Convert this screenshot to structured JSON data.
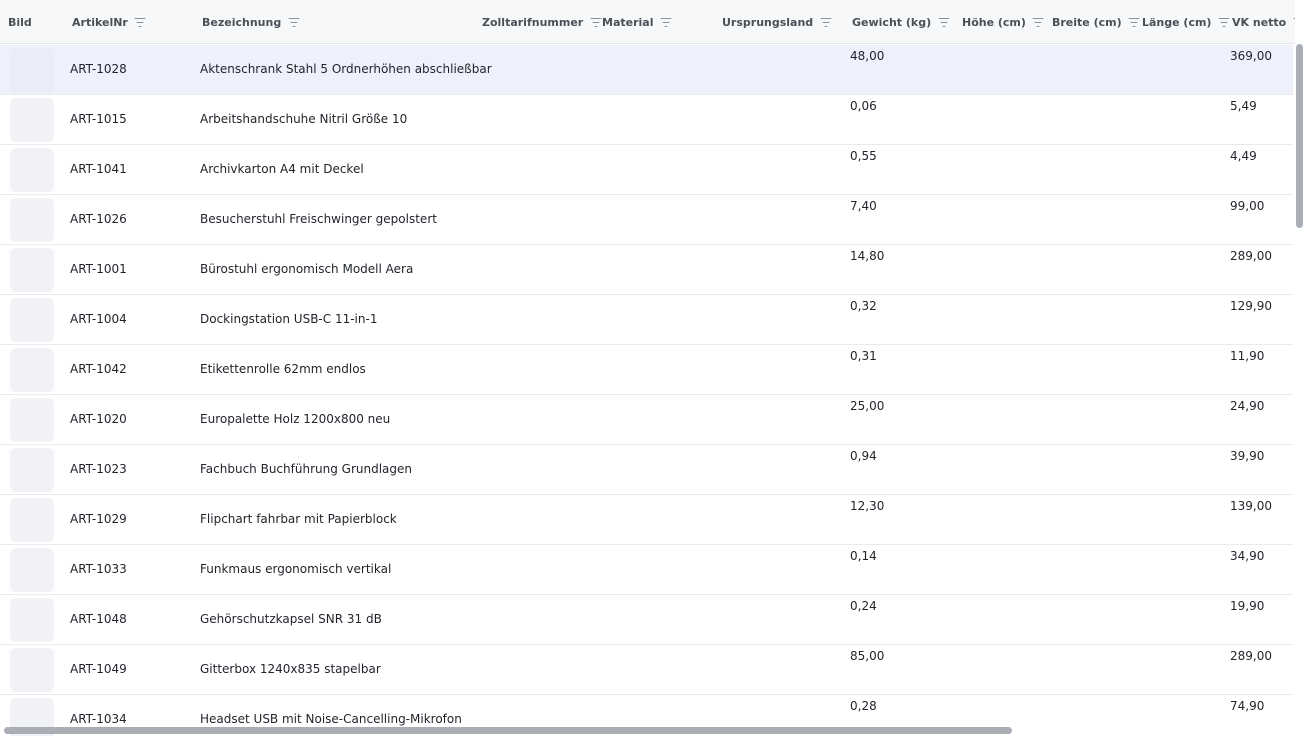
{
  "columns": {
    "bild": "Bild",
    "artikelnr": "ArtikelNr",
    "bezeichnung": "Bezeichnung",
    "zolltarifnummer": "Zolltarifnummer",
    "material": "Material",
    "ursprungsland": "Ursprungsland",
    "gewicht": "Gewicht (kg)",
    "hoehe": "Höhe (cm)",
    "breite": "Breite (cm)",
    "laenge": "Länge (cm)",
    "vknetto": "VK netto"
  },
  "rows": [
    {
      "nr": "ART-1028",
      "name": "Aktenschrank Stahl 5 Ordnerhöhen abschließbar",
      "gewicht": "48,00",
      "vk": "369,00",
      "selected": true
    },
    {
      "nr": "ART-1015",
      "name": "Arbeitshandschuhe Nitril Größe 10",
      "gewicht": "0,06",
      "vk": "5,49"
    },
    {
      "nr": "ART-1041",
      "name": "Archivkarton A4 mit Deckel",
      "gewicht": "0,55",
      "vk": "4,49"
    },
    {
      "nr": "ART-1026",
      "name": "Besucherstuhl Freischwinger gepolstert",
      "gewicht": "7,40",
      "vk": "99,00"
    },
    {
      "nr": "ART-1001",
      "name": "Bürostuhl ergonomisch Modell Aera",
      "gewicht": "14,80",
      "vk": "289,00"
    },
    {
      "nr": "ART-1004",
      "name": "Dockingstation USB-C 11-in-1",
      "gewicht": "0,32",
      "vk": "129,90"
    },
    {
      "nr": "ART-1042",
      "name": "Etikettenrolle 62mm endlos",
      "gewicht": "0,31",
      "vk": "11,90"
    },
    {
      "nr": "ART-1020",
      "name": "Europalette Holz 1200x800 neu",
      "gewicht": "25,00",
      "vk": "24,90"
    },
    {
      "nr": "ART-1023",
      "name": "Fachbuch Buchführung Grundlagen",
      "gewicht": "0,94",
      "vk": "39,90"
    },
    {
      "nr": "ART-1029",
      "name": "Flipchart fahrbar mit Papierblock",
      "gewicht": "12,30",
      "vk": "139,00"
    },
    {
      "nr": "ART-1033",
      "name": "Funkmaus ergonomisch vertikal",
      "gewicht": "0,14",
      "vk": "34,90"
    },
    {
      "nr": "ART-1048",
      "name": "Gehörschutzkapsel SNR 31 dB",
      "gewicht": "0,24",
      "vk": "19,90"
    },
    {
      "nr": "ART-1049",
      "name": "Gitterbox 1240x835 stapelbar",
      "gewicht": "85,00",
      "vk": "289,00"
    },
    {
      "nr": "ART-1034",
      "name": "Headset USB mit Noise-Cancelling-Mikrofon",
      "gewicht": "0,28",
      "vk": "74,90"
    }
  ],
  "icons": {
    "filter": "filter-icon",
    "thumbnail": "image-placeholder"
  },
  "colors": {
    "header_bg": "#f7f8fa",
    "selected_row_bg": "#eef1fb",
    "scrollbar": "#a9aeb5"
  }
}
